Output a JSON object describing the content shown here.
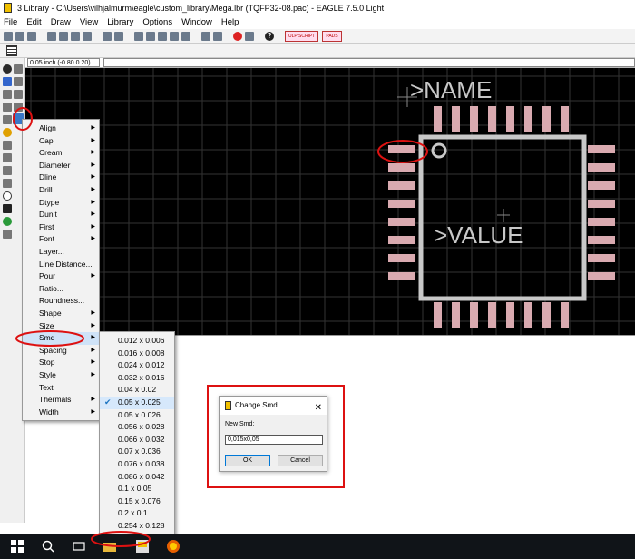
{
  "window": {
    "title": "3 Library - C:\\Users\\vilhjalmurm\\eagle\\custom_library\\Mega.lbr (TQFP32-08.pac) - EAGLE 7.5.0 Light"
  },
  "menubar": [
    "File",
    "Edit",
    "Draw",
    "View",
    "Library",
    "Options",
    "Window",
    "Help"
  ],
  "toolbar": {
    "script_button_1": "ULP SCRIPT",
    "script_button_2": "PADS"
  },
  "coords": {
    "readout": "0.05 inch (-0.80 0.20)"
  },
  "canvas": {
    "name_label": ">NAME",
    "value_label": ">VALUE"
  },
  "change_menu": {
    "items": [
      {
        "label": "Align",
        "submenu": true
      },
      {
        "label": "Cap",
        "submenu": true
      },
      {
        "label": "Cream",
        "submenu": true
      },
      {
        "label": "Diameter",
        "submenu": true
      },
      {
        "label": "Dline",
        "submenu": true
      },
      {
        "label": "Drill",
        "submenu": true
      },
      {
        "label": "Dtype",
        "submenu": true
      },
      {
        "label": "Dunit",
        "submenu": true
      },
      {
        "label": "First",
        "submenu": true
      },
      {
        "label": "Font",
        "submenu": true
      },
      {
        "label": "Layer...",
        "submenu": false
      },
      {
        "label": "Line Distance...",
        "submenu": false
      },
      {
        "label": "Pour",
        "submenu": true
      },
      {
        "label": "Ratio...",
        "submenu": false
      },
      {
        "label": "Roundness...",
        "submenu": false
      },
      {
        "label": "Shape",
        "submenu": true
      },
      {
        "label": "Size",
        "submenu": true
      },
      {
        "label": "Smd",
        "submenu": true
      },
      {
        "label": "Spacing",
        "submenu": true
      },
      {
        "label": "Stop",
        "submenu": true
      },
      {
        "label": "Style",
        "submenu": true
      },
      {
        "label": "Text",
        "submenu": false
      },
      {
        "label": "Thermals",
        "submenu": true
      },
      {
        "label": "Width",
        "submenu": true
      }
    ],
    "highlighted": "Smd"
  },
  "smd_submenu": {
    "items": [
      "0.012 x 0.006",
      "0.016 x 0.008",
      "0.024 x 0.012",
      "0.032 x 0.016",
      "0.04 x 0.02",
      "0.05 x 0.025",
      "0.05 x 0.026",
      "0.056 x 0.028",
      "0.066 x 0.032",
      "0.07 x 0.036",
      "0.076 x 0.038",
      "0.086 x 0.042",
      "0.1 x 0.05",
      "0.15 x 0.076",
      "0.2 x 0.1",
      "0.254 x 0.128",
      "..."
    ],
    "checked": "0.05 x 0.025"
  },
  "dialog": {
    "title": "Change Smd",
    "close_glyph": "✕",
    "field_label": "New Smd:",
    "field_value": "0,015x0,05",
    "ok_label": "OK",
    "cancel_label": "Cancel"
  },
  "colors": {
    "canvas_bg": "#000000",
    "pad": "#d9aab0",
    "outline": "#c8c8c8",
    "grid": "#333333",
    "highlight_red": "#dd1111"
  }
}
